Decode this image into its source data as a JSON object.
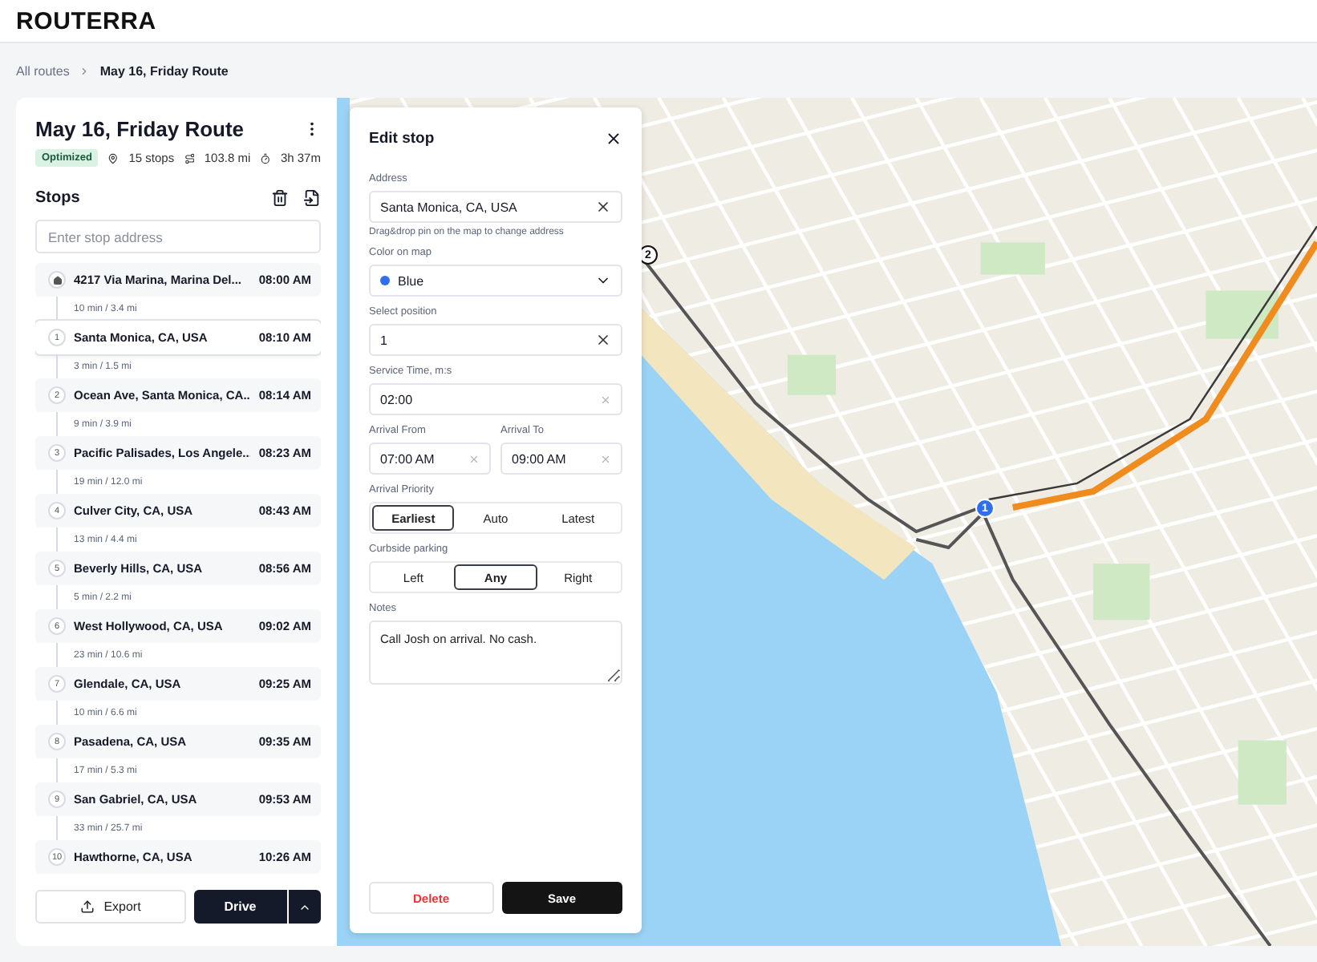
{
  "brand": "ROUTERRA",
  "breadcrumbs": [
    {
      "label": "All routes",
      "current": false
    },
    {
      "label": "May 16, Friday Route",
      "current": true
    }
  ],
  "route": {
    "title": "May 16, Friday Route",
    "status": "Optimized",
    "stops_count": "15 stops",
    "distance": "103.8 mi",
    "duration": "3h 37m"
  },
  "stops_panel": {
    "heading": "Stops",
    "search": {
      "placeholder": "Enter stop address"
    },
    "stops": [
      {
        "kind": "depot",
        "address": "4217 Via Marina, Marina Del...",
        "time": "08:00 AM",
        "selected": false,
        "leg": "10 min / 3.4 mi"
      },
      {
        "kind": "stop",
        "number": "1",
        "address": "Santa Monica, CA, USA",
        "time": "08:10 AM",
        "selected": true,
        "leg": "3 min / 1.5 mi"
      },
      {
        "kind": "stop",
        "number": "2",
        "address": "Ocean Ave, Santa Monica, CA...",
        "time": "08:14 AM",
        "selected": false,
        "leg": "9 min / 3.9 mi"
      },
      {
        "kind": "stop",
        "number": "3",
        "address": "Pacific Palisades, Los Angele...",
        "time": "08:23 AM",
        "selected": false,
        "leg": "19 min / 12.0 mi"
      },
      {
        "kind": "stop",
        "number": "4",
        "address": "Culver City, CA, USA",
        "time": "08:43 AM",
        "selected": false,
        "leg": "13 min / 4.4 mi"
      },
      {
        "kind": "stop",
        "number": "5",
        "address": "Beverly Hills, CA, USA",
        "time": "08:56 AM",
        "selected": false,
        "leg": "5 min / 2.2 mi"
      },
      {
        "kind": "stop",
        "number": "6",
        "address": "West Hollywood, CA, USA",
        "time": "09:02 AM",
        "selected": false,
        "leg": "23 min / 10.6 mi"
      },
      {
        "kind": "stop",
        "number": "7",
        "address": "Glendale, CA, USA",
        "time": "09:25 AM",
        "selected": false,
        "leg": "10 min / 6.6 mi"
      },
      {
        "kind": "stop",
        "number": "8",
        "address": "Pasadena, CA, USA",
        "time": "09:35 AM",
        "selected": false,
        "leg": "17 min / 5.3 mi"
      },
      {
        "kind": "stop",
        "number": "9",
        "address": "San Gabriel, CA, USA",
        "time": "09:53 AM",
        "selected": false,
        "leg": "33 min / 25.7 mi"
      },
      {
        "kind": "stop",
        "number": "10",
        "address": "Hawthorne, CA, USA",
        "time": "10:26 AM",
        "selected": false
      }
    ],
    "export_button": "Export",
    "drive_button": "Drive"
  },
  "edit_stop": {
    "title": "Edit stop",
    "address": {
      "label": "Address",
      "value": "Santa Monica, CA, USA",
      "hint": "Drag&drop pin on the map to change address"
    },
    "color": {
      "label": "Color on map",
      "value": "Blue",
      "color": "#2f6fed"
    },
    "position": {
      "label": "Select position",
      "value": "1"
    },
    "service_time": {
      "label": "Service Time, m:s",
      "value": "02:00"
    },
    "arrival_from": {
      "label": "Arrival From",
      "value": "07:00 AM"
    },
    "arrival_to": {
      "label": "Arrival To",
      "value": "09:00 AM"
    },
    "arrival_priority": {
      "label": "Arrival Priority",
      "options": [
        {
          "label": "Earliest",
          "selected": true
        },
        {
          "label": "Auto",
          "selected": false
        },
        {
          "label": "Latest",
          "selected": false
        }
      ]
    },
    "curbside_parking": {
      "label": "Curbside parking",
      "options": [
        {
          "label": "Left",
          "selected": false
        },
        {
          "label": "Any",
          "selected": true
        },
        {
          "label": "Right",
          "selected": false
        }
      ]
    },
    "notes": {
      "label": "Notes",
      "value": "Call Josh on arrival. No cash."
    },
    "delete_button": "Delete",
    "save_button": "Save"
  },
  "map": {
    "markers": [
      {
        "label": "2",
        "kind": "outline"
      },
      {
        "label": "1",
        "kind": "active"
      }
    ]
  }
}
